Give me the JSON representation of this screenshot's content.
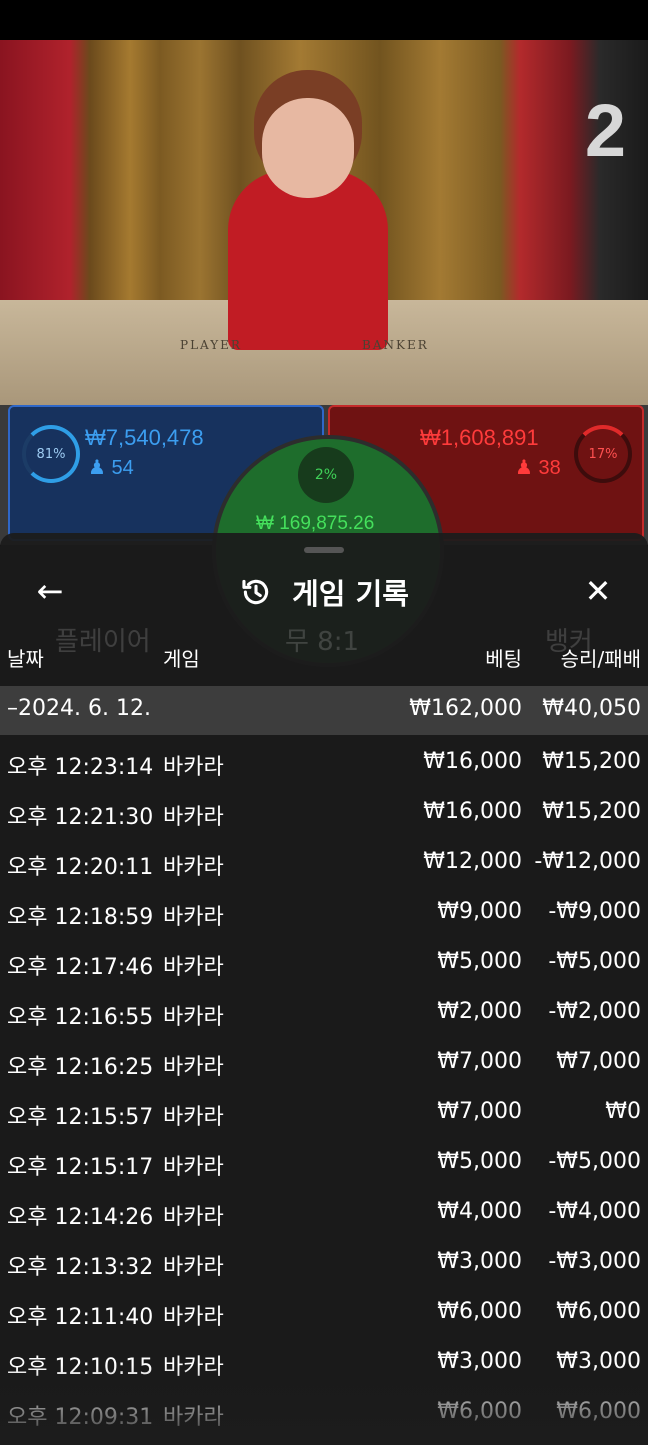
{
  "video": {
    "round_number": "2",
    "table_left_label": "PLAYER",
    "table_right_label": "BANKER"
  },
  "betting": {
    "player": {
      "percent": "81%",
      "amount": "₩7,540,478",
      "players": "54"
    },
    "banker": {
      "percent": "17%",
      "amount": "₩1,608,891",
      "players": "38"
    },
    "tie": {
      "percent": "2%",
      "amount": "₩ 169,875.26"
    }
  },
  "panel": {
    "title": "게임 기록",
    "columns": {
      "date": "날짜",
      "game": "게임",
      "bet": "베팅",
      "result": "승리/패배"
    },
    "date_group": {
      "label": "–2024. 6. 12.",
      "bet_total": "₩162,000",
      "result_total": "₩40,050"
    },
    "rows": [
      {
        "time": "오후 12:23:14",
        "game": "바카라",
        "bet": "₩16,000",
        "result": "₩15,200"
      },
      {
        "time": "오후 12:21:30",
        "game": "바카라",
        "bet": "₩16,000",
        "result": "₩15,200"
      },
      {
        "time": "오후 12:20:11",
        "game": "바카라",
        "bet": "₩12,000",
        "result": "-₩12,000"
      },
      {
        "time": "오후 12:18:59",
        "game": "바카라",
        "bet": "₩9,000",
        "result": "-₩9,000"
      },
      {
        "time": "오후 12:17:46",
        "game": "바카라",
        "bet": "₩5,000",
        "result": "-₩5,000"
      },
      {
        "time": "오후 12:16:55",
        "game": "바카라",
        "bet": "₩2,000",
        "result": "-₩2,000"
      },
      {
        "time": "오후 12:16:25",
        "game": "바카라",
        "bet": "₩7,000",
        "result": "₩7,000"
      },
      {
        "time": "오후 12:15:57",
        "game": "바카라",
        "bet": "₩7,000",
        "result": "₩0"
      },
      {
        "time": "오후 12:15:17",
        "game": "바카라",
        "bet": "₩5,000",
        "result": "-₩5,000"
      },
      {
        "time": "오후 12:14:26",
        "game": "바카라",
        "bet": "₩4,000",
        "result": "-₩4,000"
      },
      {
        "time": "오후 12:13:32",
        "game": "바카라",
        "bet": "₩3,000",
        "result": "-₩3,000"
      },
      {
        "time": "오후 12:11:40",
        "game": "바카라",
        "bet": "₩6,000",
        "result": "₩6,000"
      },
      {
        "time": "오후 12:10:15",
        "game": "바카라",
        "bet": "₩3,000",
        "result": "₩3,000"
      },
      {
        "time": "오후 12:09:31",
        "game": "바카라",
        "bet": "₩6,000",
        "result": "₩6,000"
      }
    ]
  },
  "background_labels": {
    "player": "플레이어",
    "tie": "무 8:1",
    "banker": "뱅커"
  },
  "colors": {
    "player_blue": "#2f67c7",
    "banker_red": "#c42a2a",
    "tie_green": "#1e6d2c"
  }
}
